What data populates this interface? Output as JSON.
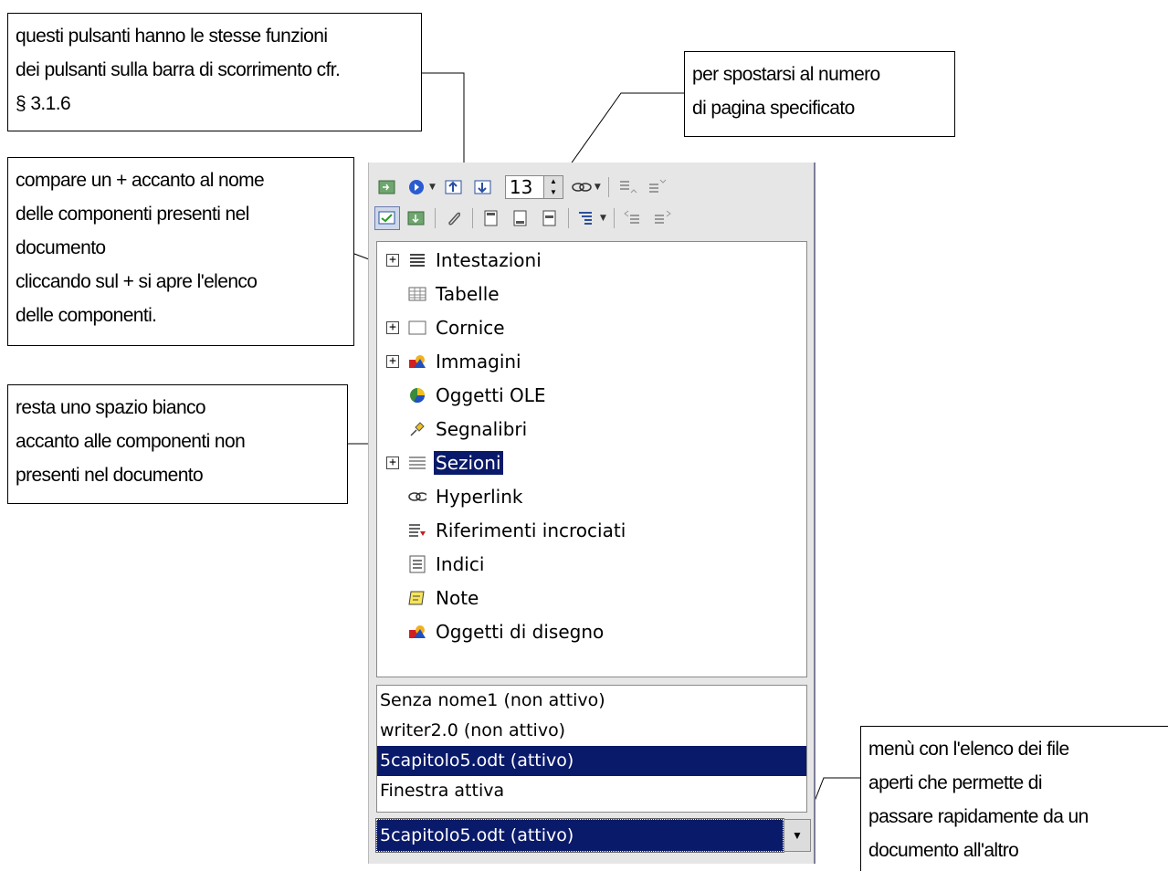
{
  "callouts": {
    "scroll_buttons": [
      "questi pulsanti hanno le stesse funzioni",
      "dei pulsanti sulla barra di scorrimento cfr.",
      "§ 3.1.6"
    ],
    "page_number": [
      "per spostarsi al numero",
      "di pagina specificato"
    ],
    "plus_sign": [
      "compare un + accanto al nome",
      "delle componenti  presenti nel",
      "documento",
      "cliccando sul + si apre l'elenco",
      "delle componenti."
    ],
    "blank_space": [
      "resta uno spazio bianco",
      "accanto alle componenti  non",
      "presenti nel documento"
    ],
    "file_menu": [
      "menù con l'elenco dei file",
      "aperti che permette di",
      "passare rapidamente da un",
      "documento all'altro"
    ]
  },
  "toolbar": {
    "page_number": "13"
  },
  "tree": {
    "items": [
      {
        "label": "Intestazioni",
        "expander": true,
        "icon": "headings-icon"
      },
      {
        "label": "Tabelle",
        "expander": false,
        "icon": "table-icon"
      },
      {
        "label": "Cornice",
        "expander": true,
        "icon": "frame-icon"
      },
      {
        "label": "Immagini",
        "expander": true,
        "icon": "images-icon"
      },
      {
        "label": "Oggetti OLE",
        "expander": false,
        "icon": "ole-icon"
      },
      {
        "label": "Segnalibri",
        "expander": false,
        "icon": "bookmark-icon"
      },
      {
        "label": "Sezioni",
        "expander": true,
        "icon": "sections-icon",
        "selected": true
      },
      {
        "label": "Hyperlink",
        "expander": false,
        "icon": "hyperlink-icon"
      },
      {
        "label": "Riferimenti incrociati",
        "expander": false,
        "icon": "cross-reference-icon"
      },
      {
        "label": "Indici",
        "expander": false,
        "icon": "index-icon"
      },
      {
        "label": "Note",
        "expander": false,
        "icon": "note-icon"
      },
      {
        "label": "Oggetti di disegno",
        "expander": false,
        "icon": "drawing-objects-icon"
      }
    ]
  },
  "documents": {
    "items": [
      "Senza nome1 (non attivo)",
      "writer2.0 (non attivo)",
      "5capitolo5.odt (attivo)",
      "Finestra attiva"
    ],
    "selected": "5capitolo5.odt (attivo)"
  },
  "colors": {
    "selection": "#0a1a6a",
    "panel": "#e6e6e6"
  }
}
